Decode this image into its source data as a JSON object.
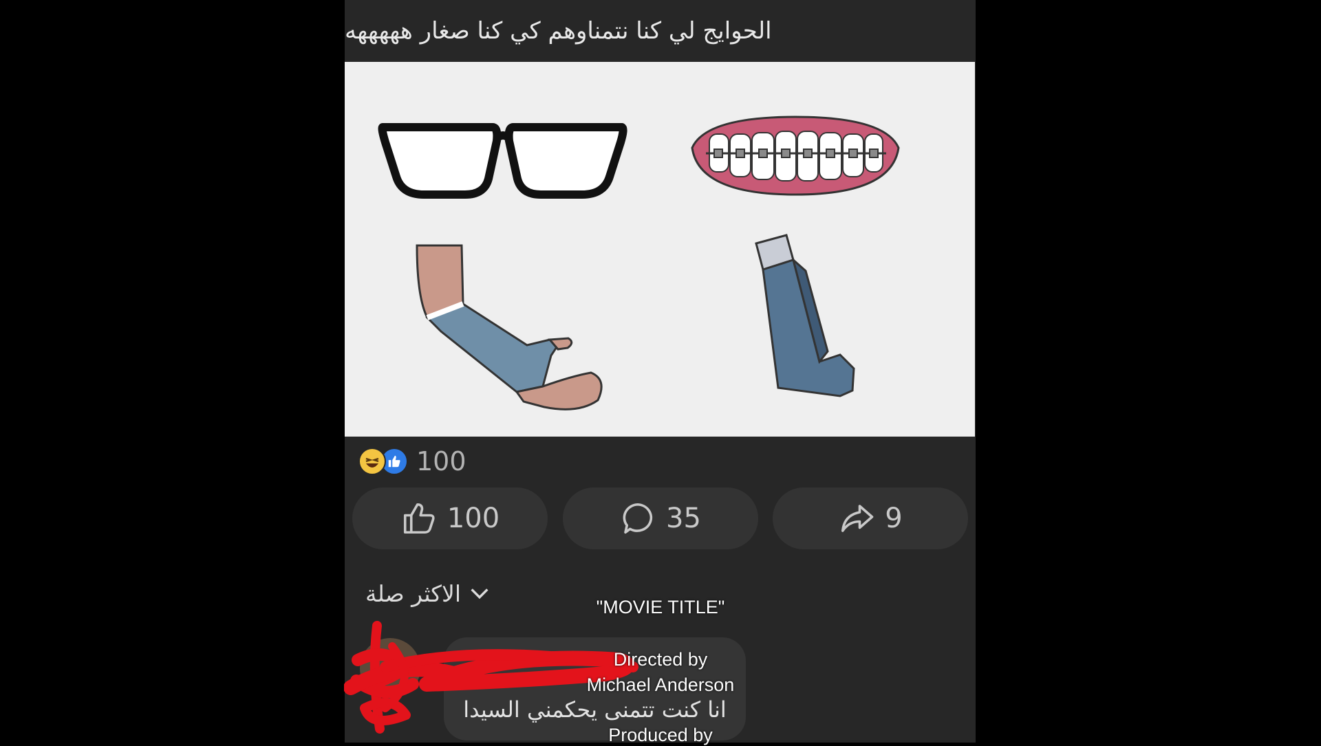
{
  "post": {
    "caption": "الحوايج لي كنا نتمناوهم كي كنا صغار هههههه",
    "image_items": [
      "glasses-icon",
      "braces-icon",
      "arm-cast-icon",
      "inhaler-icon"
    ]
  },
  "reactions": {
    "icons": [
      "haha-icon",
      "like-icon"
    ],
    "count": "100"
  },
  "actions": {
    "like_count": "100",
    "comment_count": "35",
    "share_count": "9"
  },
  "comments": {
    "sort_label": "الاكثر صلة",
    "first_comment_text": "انا كنت تتمنى يحكمني السيدا"
  },
  "overlay": {
    "title": "\"MOVIE TITLE\"",
    "directed_by": "Directed by",
    "director": "Michael Anderson",
    "produced_by": "Produced by"
  },
  "colors": {
    "page_background": "#000000",
    "post_background": "#272727",
    "button_background": "#333333",
    "like_blue": "#2e7be6",
    "scribble_red": "#e3131b"
  }
}
